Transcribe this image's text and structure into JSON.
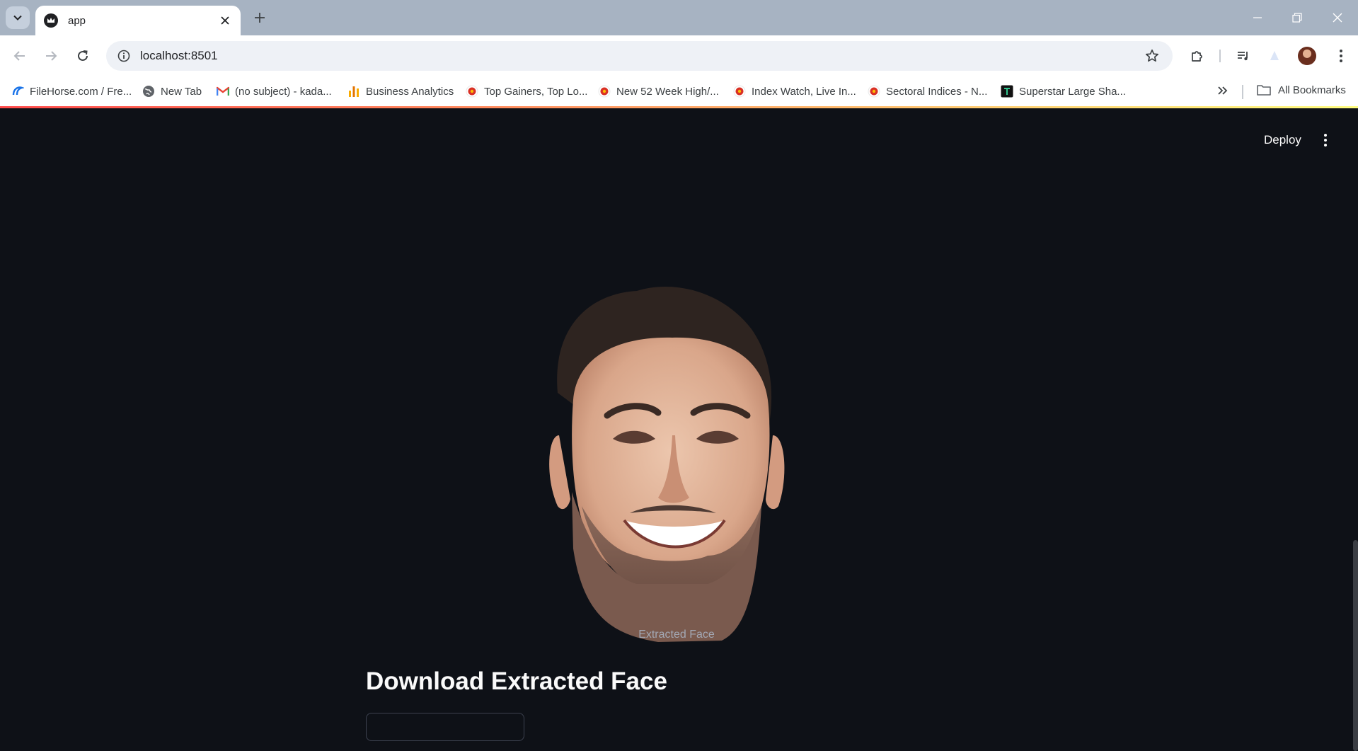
{
  "browser": {
    "tab_title": "app",
    "url": "localhost:8501",
    "bookmarks": [
      {
        "label": "FileHorse.com / Fre...",
        "icon": "filehorse-icon"
      },
      {
        "label": "New Tab",
        "icon": "globe-icon"
      },
      {
        "label": "(no subject) - kada...",
        "icon": "gmail-icon"
      },
      {
        "label": "Business Analytics",
        "icon": "analytics-icon"
      },
      {
        "label": "Top Gainers, Top Lo...",
        "icon": "moneycontrol-icon"
      },
      {
        "label": "New 52 Week High/...",
        "icon": "moneycontrol-icon"
      },
      {
        "label": "Index Watch, Live In...",
        "icon": "moneycontrol-icon"
      },
      {
        "label": "Sectoral Indices - N...",
        "icon": "moneycontrol-icon"
      },
      {
        "label": "Superstar Large Sha...",
        "icon": "trendlyne-icon"
      }
    ],
    "all_bookmarks_label": "All Bookmarks"
  },
  "app": {
    "deploy_label": "Deploy",
    "image_caption": "Extracted Face",
    "download_heading": "Download Extracted Face"
  },
  "colors": {
    "app_background": "#0e1117",
    "header_decoration_start": "#ff4b4b",
    "header_decoration_end": "#fffd80",
    "titlebar": "#a7b3c2"
  }
}
